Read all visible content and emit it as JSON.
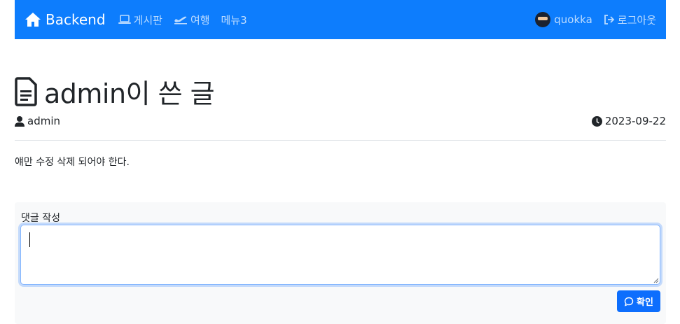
{
  "navbar": {
    "brand": "Backend",
    "links": [
      {
        "label": "게시판",
        "icon": "laptop-icon"
      },
      {
        "label": "여행",
        "icon": "airplane-icon"
      },
      {
        "label": "메뉴3"
      }
    ],
    "user": {
      "name": "quokka",
      "avatar": "ninja-avatar"
    },
    "logout": {
      "label": "로그아웃",
      "icon": "logout-icon"
    },
    "colors": {
      "background": "#0d7dfd",
      "text": "#ffffff"
    }
  },
  "post": {
    "title": "admin이 쓴 글",
    "title_icon": "file-text-icon",
    "author": "admin",
    "author_icon": "person-icon",
    "date": "2023-09-22",
    "date_icon": "clock-icon",
    "body": "얘만 수정 삭제 되어야 한다."
  },
  "comment_form": {
    "label": "댓글 작성",
    "value": "",
    "submit_label": "확인",
    "submit_icon": "chat-icon",
    "colors": {
      "button": "#0d6efd",
      "panel": "#f8f9fa"
    }
  }
}
